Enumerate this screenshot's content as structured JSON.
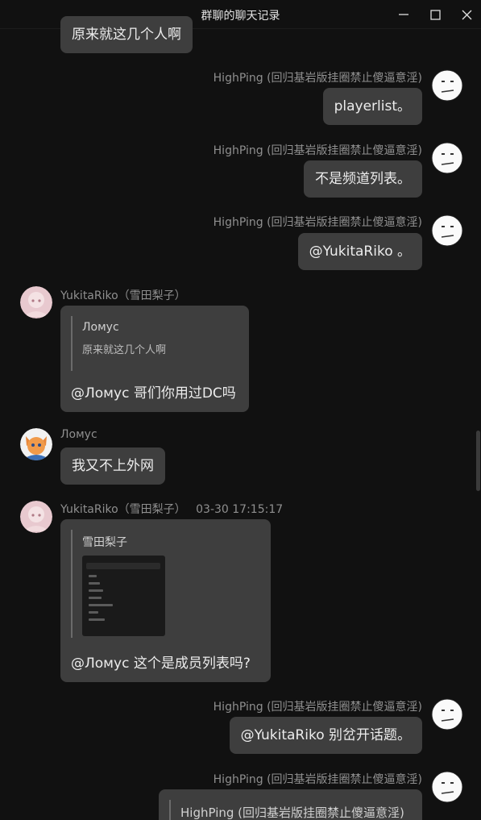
{
  "window": {
    "title": "群聊的聊天记录"
  },
  "icons": {
    "minimize": "minimize-icon",
    "maximize": "maximize-icon",
    "close": "close-icon"
  },
  "colors": {
    "background": "#111111",
    "bubble": "#3e3e3e",
    "sender": "#8f8f8f"
  },
  "messages": [
    {
      "text": "原来就这几个人啊"
    },
    {
      "sender": "HighPing (回归基岩版挂圈禁止傻逼意淫)",
      "text": "playerlist。"
    },
    {
      "sender": "HighPing (回归基岩版挂圈禁止傻逼意淫)",
      "text": "不是频道列表。"
    },
    {
      "sender": "HighPing (回归基岩版挂圈禁止傻逼意淫)",
      "text": "@YukitaRiko 。"
    },
    {
      "sender": "YukitaRiko（雪田梨子）",
      "quote_name": "Ломус",
      "quote_text": "原来就这几个人啊",
      "text": "@Ломус 哥们你用过DC吗"
    },
    {
      "sender": "Ломус",
      "text": "我又不上外网"
    },
    {
      "sender": "YukitaRiko（雪田梨子）",
      "time": "03-30 17:15:17",
      "quote_name": "雪田梨子",
      "quote_image": "screenshot-thumbnail",
      "text": "@Ломус 这个是成员列表吗?"
    },
    {
      "sender": "HighPing (回归基岩版挂圈禁止傻逼意淫)",
      "text": "@YukitaRiko 别岔开话题。"
    },
    {
      "sender": "HighPing (回归基岩版挂圈禁止傻逼意淫)",
      "quote_name": "HighPing (回归基岩版挂圈禁止傻逼意淫)"
    }
  ]
}
